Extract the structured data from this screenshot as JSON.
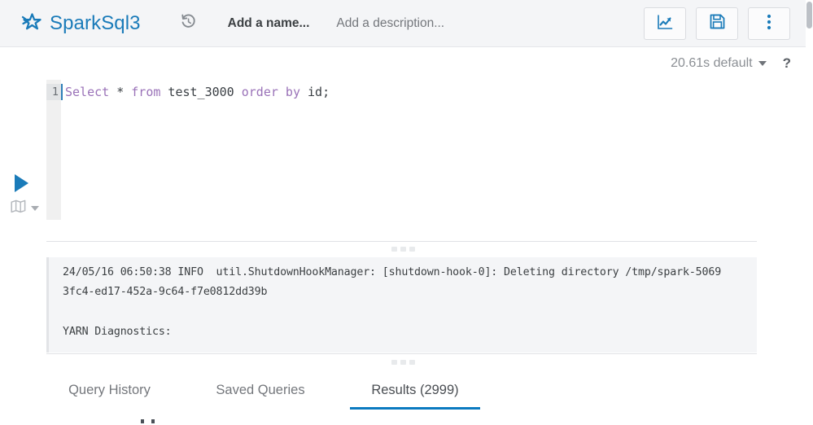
{
  "header": {
    "logo_icon": "spark-star-icon",
    "app_title": "SparkSql3",
    "history_icon": "history-revert-icon",
    "name_placeholder": "Add a name...",
    "description_placeholder": "Add a description...",
    "actions": [
      {
        "name": "chart-view-button",
        "icon": "line-chart-icon",
        "label": ""
      },
      {
        "name": "save-button",
        "icon": "floppy-save-icon",
        "label": ""
      },
      {
        "name": "more-options-button",
        "icon": "vertical-dots-icon",
        "label": ""
      }
    ]
  },
  "meta": {
    "duration_and_db": "20.61s default",
    "caret_icon": "chevron-down-icon",
    "help_label": "?"
  },
  "editor": {
    "run_icon": "play-run-icon",
    "database_icon": "book-map-icon",
    "database_caret_icon": "chevron-down-icon",
    "line_number": "1",
    "tokens": [
      {
        "text": "Select",
        "type": "keyword"
      },
      {
        "text": " * ",
        "type": "punctuation"
      },
      {
        "text": "from",
        "type": "keyword"
      },
      {
        "text": " test_3000 ",
        "type": "identifier"
      },
      {
        "text": "order by",
        "type": "keyword"
      },
      {
        "text": " id;",
        "type": "identifier"
      }
    ],
    "full_query": "Select * from test_3000 order by id;"
  },
  "log": {
    "drag_handle_icon": "drag-dots-icon",
    "lines": [
      "24/05/16 06:50:38 INFO  util.ShutdownHookManager: [shutdown-hook-0]: Deleting directory /tmp/spark-5069",
      "3fc4-ed17-452a-9c64-f7e0812dd39b",
      "YARN Diagnostics:"
    ]
  },
  "tabs": [
    {
      "name": "tab-query-history",
      "label": "Query History",
      "active": false
    },
    {
      "name": "tab-saved-queries",
      "label": "Saved Queries",
      "active": false
    },
    {
      "name": "tab-results",
      "label": "Results (2999)",
      "active": true
    }
  ],
  "colors": {
    "brand_blue": "#1a7bb9",
    "accent_underline": "#0b7ac0",
    "keyword_purple": "#9a72b8",
    "header_bg": "#f4f5f7",
    "log_bg": "#f4f5f7",
    "muted_text": "#74777c"
  }
}
